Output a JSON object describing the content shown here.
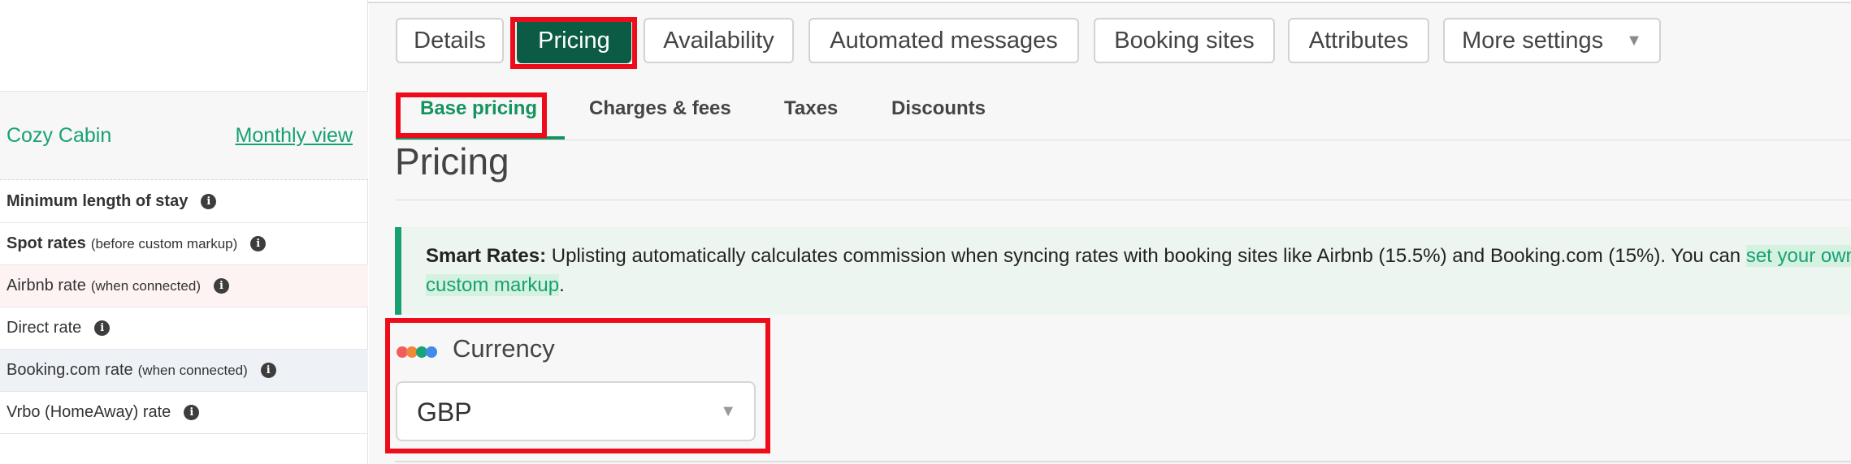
{
  "tabs": [
    {
      "label": "Details"
    },
    {
      "label": "Pricing"
    },
    {
      "label": "Availability"
    },
    {
      "label": "Automated messages"
    },
    {
      "label": "Booking sites"
    },
    {
      "label": "Attributes"
    },
    {
      "label": "More settings"
    }
  ],
  "active_tab": "Pricing",
  "subtabs": [
    {
      "label": "Base pricing"
    },
    {
      "label": "Charges & fees"
    },
    {
      "label": "Taxes"
    },
    {
      "label": "Discounts"
    }
  ],
  "active_subtab": "Base pricing",
  "sidebar": {
    "listing_name": "Cozy Cabin",
    "view_link": "Monthly view",
    "rows": [
      {
        "label": "Minimum length of stay",
        "note": ""
      },
      {
        "label": "Spot rates",
        "note": "(before custom markup)"
      },
      {
        "label": "Airbnb rate",
        "note": "(when connected)"
      },
      {
        "label": "Direct rate",
        "note": ""
      },
      {
        "label": "Booking.com rate",
        "note": "(when connected)"
      },
      {
        "label": "Vrbo (HomeAway) rate",
        "note": ""
      }
    ]
  },
  "page": {
    "title": "Pricing"
  },
  "banner": {
    "heading": "Smart Rates:",
    "text": " Uplisting automatically calculates commission when syncing rates with booking sites like Airbnb (15.5%) and Booking.com (15%). You can ",
    "link": "set your own custom markup",
    "tail": "."
  },
  "currency": {
    "label": "Currency",
    "value": "GBP"
  },
  "icons": {
    "info": "info-icon",
    "dropdown": "caret-down-icon",
    "currency": "colored-dots-icon"
  },
  "colors": {
    "accent": "#17a173",
    "active_tab": "#0c5c45",
    "highlight_box": "#ee0c1a",
    "dots": [
      "#f25c5c",
      "#f0883a",
      "#1aa374",
      "#3e8de8"
    ]
  }
}
